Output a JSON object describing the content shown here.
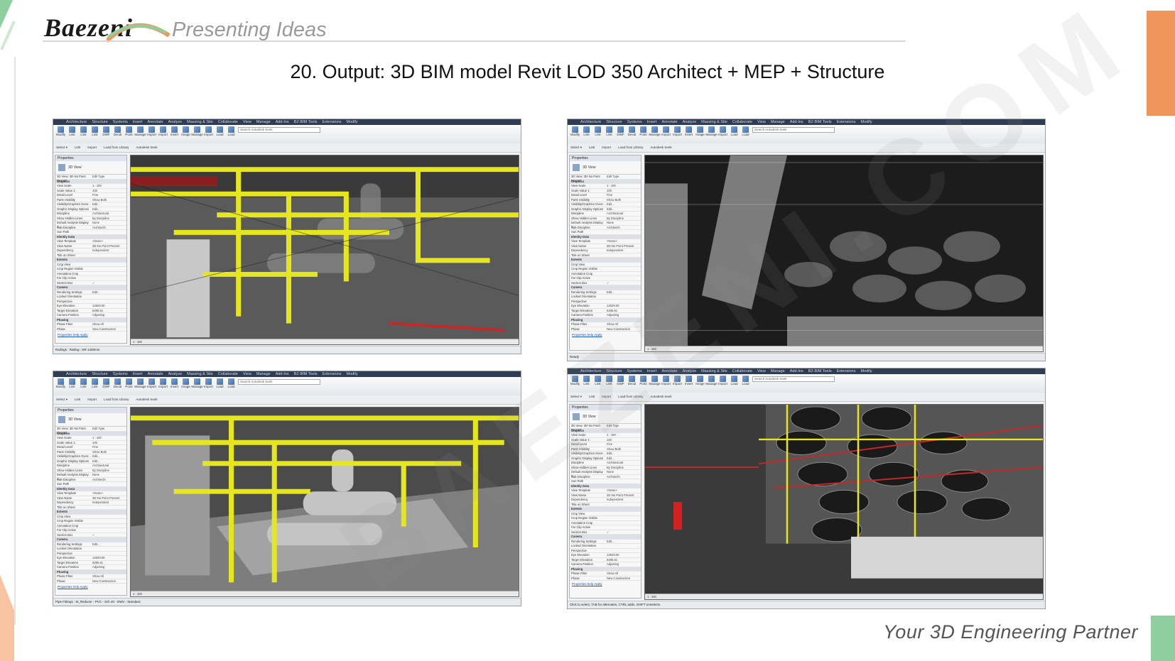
{
  "brand": {
    "logo_text": "Baezeni",
    "tagline": "Presenting Ideas"
  },
  "slide": {
    "title": "20. Output: 3D BIM model Revit LOD 350 Architect + MEP + Structure"
  },
  "footer": {
    "text": "Your 3D Engineering Partner"
  },
  "colors": {
    "accent_orange": "#f2955a",
    "accent_green": "#8fcf9f",
    "pipe_yellow": "#e6e61e",
    "pipe_red": "#c62828"
  },
  "revit": {
    "tabs": [
      "Architecture",
      "Structure",
      "Systems",
      "Insert",
      "Annotate",
      "Analyze",
      "Massing & Site",
      "Collaborate",
      "View",
      "Manage",
      "Add-Ins",
      "BZ-BIM Tools",
      "Extensions",
      "Modify"
    ],
    "ribbon_buttons": [
      "Modify",
      "Link Revit",
      "Link IFC",
      "Link CAD",
      "DWF Markup",
      "Decal",
      "Point Cloud",
      "Manage Links",
      "Import CAD",
      "Import gbXML",
      "Insert from File",
      "Image",
      "Manage Images",
      "Import Family Types",
      "Load Family",
      "Load as Group"
    ],
    "search_placeholder": "Search Autodesk Seek",
    "subbar_items": [
      "Select ▾",
      "Link",
      "Import",
      "Load from Library",
      "Autodesk Seek"
    ],
    "properties": {
      "header": "Properties",
      "type_name": "3D View",
      "view_selector": "3D View: 3D-No Point Present",
      "edit_type": "Edit Type",
      "rows": [
        {
          "k": "Graphics",
          "v": "",
          "section": true
        },
        {
          "k": "View Scale",
          "v": "1 : 100"
        },
        {
          "k": "Scale Value 1:",
          "v": "100"
        },
        {
          "k": "Detail Level",
          "v": "Fine"
        },
        {
          "k": "Parts Visibility",
          "v": "Show Both"
        },
        {
          "k": "Visibility/Graphics Overr...",
          "v": "Edit..."
        },
        {
          "k": "Graphic Display Options",
          "v": "Edit..."
        },
        {
          "k": "Discipline",
          "v": "Architectural"
        },
        {
          "k": "Show Hidden Lines",
          "v": "By Discipline"
        },
        {
          "k": "Default Analysis Display S...",
          "v": "None"
        },
        {
          "k": "Sub-Discipline",
          "v": "Architecht"
        },
        {
          "k": "Sun Path",
          "v": ""
        },
        {
          "k": "Identity Data",
          "v": "",
          "section": true
        },
        {
          "k": "View Template",
          "v": "<None>"
        },
        {
          "k": "View Name",
          "v": "3D-No Point Present"
        },
        {
          "k": "Dependency",
          "v": "Independent"
        },
        {
          "k": "Title on Sheet",
          "v": ""
        },
        {
          "k": "Extents",
          "v": "",
          "section": true
        },
        {
          "k": "Crop View",
          "v": ""
        },
        {
          "k": "Crop Region Visible",
          "v": ""
        },
        {
          "k": "Annotation Crop",
          "v": ""
        },
        {
          "k": "Far Clip Active",
          "v": ""
        },
        {
          "k": "Section Box",
          "v": "✓"
        },
        {
          "k": "Camera",
          "v": "",
          "section": true
        },
        {
          "k": "Rendering Settings",
          "v": "Edit..."
        },
        {
          "k": "Locked Orientation",
          "v": ""
        },
        {
          "k": "Perspective",
          "v": ""
        },
        {
          "k": "Eye Elevation",
          "v": "12829.00"
        },
        {
          "k": "Target Elevation",
          "v": "6295.61"
        },
        {
          "k": "Camera Position",
          "v": "Adjusting"
        },
        {
          "k": "Phasing",
          "v": "",
          "section": true
        },
        {
          "k": "Phase Filter",
          "v": "Show All"
        },
        {
          "k": "Phase",
          "v": "New Construction"
        }
      ],
      "help_link": "Properties help",
      "apply": "Apply"
    },
    "view_bar": "1 : 100",
    "main_model": "Main Model",
    "statuses": [
      "Railings : Railing : NR 1400mm",
      "Ready",
      "Pipe Fittings : M_Reducer - PVC - Sch 40 - DWV : Standard",
      "Click to select, TAB for alternates, CTRL adds, SHIFT unselects."
    ]
  },
  "watermark": "BAEZENI.COM"
}
